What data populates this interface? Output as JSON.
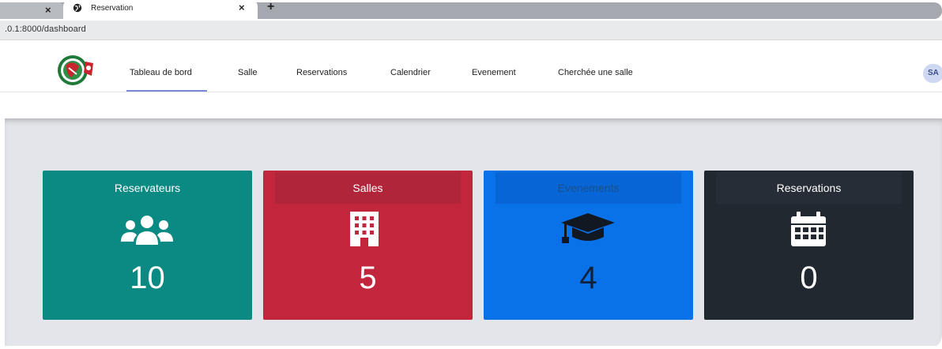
{
  "browser": {
    "prev_tab_close": "×",
    "active_tab_title": "Reservation",
    "active_tab_close": "×",
    "new_tab": "+",
    "url": ".0.1:8000/dashboard"
  },
  "navbar": {
    "items": [
      {
        "label": "Tableau de bord",
        "active": true
      },
      {
        "label": "Salle"
      },
      {
        "label": "Reservations"
      },
      {
        "label": "Calendrier"
      },
      {
        "label": "Evenement"
      },
      {
        "label": "Cherchée une salle"
      }
    ],
    "avatar_text": "SA"
  },
  "cards": [
    {
      "title": "Reservateurs",
      "value": "10",
      "icon": "users-icon",
      "bg": "#0b8a83",
      "header_bg": "#0b8a83",
      "title_color": "#ffffff",
      "value_color": "#ffffff"
    },
    {
      "title": "Salles",
      "value": "5",
      "icon": "building-icon",
      "bg": "#c2263d",
      "header_bg": "#b0253a",
      "title_color": "#ffffff",
      "value_color": "#ffffff"
    },
    {
      "title": "Evenements",
      "value": "4",
      "icon": "graduation-cap-icon",
      "bg": "#0a72e8",
      "header_bg": "#0865d6",
      "title_color": "#1c4f8a",
      "value_color": "#10223b"
    },
    {
      "title": "Reservations",
      "value": "0",
      "icon": "calendar-icon",
      "bg": "#212830",
      "header_bg": "#262d36",
      "title_color": "#ffffff",
      "value_color": "#ffffff"
    }
  ]
}
